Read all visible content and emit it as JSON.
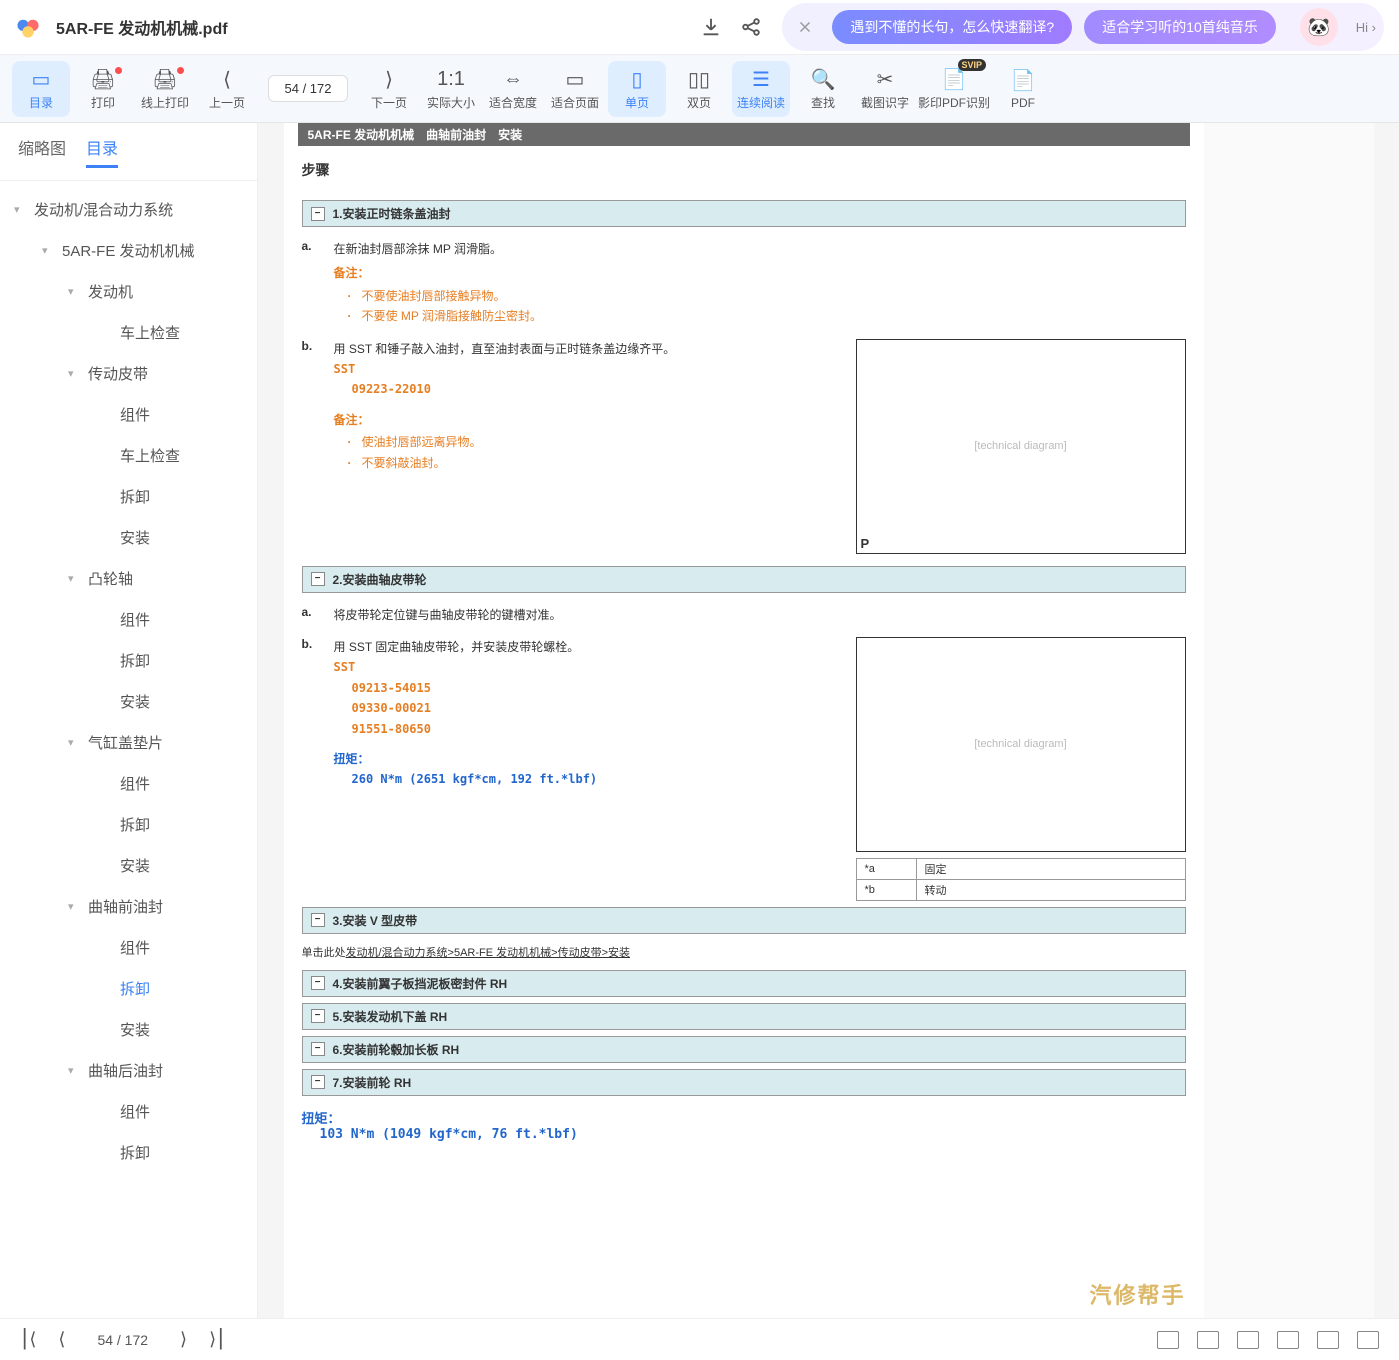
{
  "filename": "5AR-FE 发动机机械.pdf",
  "promo": {
    "pill1": "遇到不懂的长句，怎么快速翻译?",
    "pill2": "适合学习听的10首纯音乐",
    "hi": "Hi ›"
  },
  "toolbar": {
    "catalog": "目录",
    "print": "打印",
    "onlinePrint": "线上打印",
    "prevPage": "上一页",
    "pageInput": "54  / 172",
    "nextPage": "下一页",
    "actualSize": "实际大小",
    "fitWidth": "适合宽度",
    "fitPage": "适合页面",
    "singlePage": "单页",
    "doublePage": "双页",
    "continuous": "连续阅读",
    "search": "查找",
    "screenshot": "截图识字",
    "ocr": "影印PDF识别",
    "pdf": "PDF"
  },
  "sideTabs": {
    "thumbnail": "缩略图",
    "toc": "目录"
  },
  "toc": [
    {
      "lvl": 1,
      "label": "发动机/混合动力系统",
      "caret": true
    },
    {
      "lvl": 2,
      "label": "5AR-FE 发动机机械",
      "caret": true
    },
    {
      "lvl": 3,
      "label": "发动机",
      "caret": true
    },
    {
      "lvl": 4,
      "label": "车上检查"
    },
    {
      "lvl": 3,
      "label": "传动皮带",
      "caret": true
    },
    {
      "lvl": 4,
      "label": "组件"
    },
    {
      "lvl": 4,
      "label": "车上检查"
    },
    {
      "lvl": 4,
      "label": "拆卸"
    },
    {
      "lvl": 4,
      "label": "安装"
    },
    {
      "lvl": 3,
      "label": "凸轮轴",
      "caret": true
    },
    {
      "lvl": 4,
      "label": "组件"
    },
    {
      "lvl": 4,
      "label": "拆卸"
    },
    {
      "lvl": 4,
      "label": "安装"
    },
    {
      "lvl": 3,
      "label": "气缸盖垫片",
      "caret": true
    },
    {
      "lvl": 4,
      "label": "组件"
    },
    {
      "lvl": 4,
      "label": "拆卸"
    },
    {
      "lvl": 4,
      "label": "安装"
    },
    {
      "lvl": 3,
      "label": "曲轴前油封",
      "caret": true
    },
    {
      "lvl": 4,
      "label": "组件"
    },
    {
      "lvl": 4,
      "label": "拆卸",
      "active": true
    },
    {
      "lvl": 4,
      "label": "安装"
    },
    {
      "lvl": 3,
      "label": "曲轴后油封",
      "caret": true
    },
    {
      "lvl": 4,
      "label": "组件"
    },
    {
      "lvl": 4,
      "label": "拆卸"
    }
  ],
  "doc": {
    "header": "5AR-FE 发动机机械　曲轴前油封　安装",
    "stepsTitle": "步骤",
    "sec1": "1.安装正时链条盖油封",
    "s1a_letter": "a.",
    "s1a": "在新油封唇部涂抹 MP 润滑脂。",
    "note": "备注：",
    "s1a_n1": "不要使油封唇部接触异物。",
    "s1a_n2": "不要使 MP 润滑脂接触防尘密封。",
    "s1b_letter": "b.",
    "s1b": "用 SST 和锤子敲入油封，直至油封表面与正时链条盖边缘齐平。",
    "sst": "SST",
    "s1b_code": "09223-22010",
    "s1b_n1": "使油封唇部远离异物。",
    "s1b_n2": "不要斜敲油封。",
    "sec2": "2.安装曲轴皮带轮",
    "s2a_letter": "a.",
    "s2a": "将皮带轮定位键与曲轴皮带轮的键槽对准。",
    "s2b_letter": "b.",
    "s2b": "用 SST 固定曲轴皮带轮，并安装皮带轮螺栓。",
    "s2b_c1": "09213-54015",
    "s2b_c2": "09330-00021",
    "s2b_c3": "91551-80650",
    "torqueLabel": "扭矩：",
    "s2b_torque": "260 N*m (2651 kgf*cm, 192 ft.*lbf)",
    "tbl_a": "*a",
    "tbl_a_v": "固定",
    "tbl_b": "*b",
    "tbl_b_v": "转动",
    "sec3": "3.安装 V 型皮带",
    "linkPrefix": "单击此处",
    "linkText": "发动机/混合动力系统>5AR-FE 发动机机械>传动皮带>安装",
    "sec4": "4.安装前翼子板挡泥板密封件 RH",
    "sec5": "5.安装发动机下盖 RH",
    "sec6": "6.安装前轮毂加长板 RH",
    "sec7": "7.安装前轮 RH",
    "s7_torque": "103 N*m (1049 kgf*cm, 76 ft.*lbf)"
  },
  "bottom": {
    "page": "54  / 172"
  },
  "watermark": "汽修帮手"
}
